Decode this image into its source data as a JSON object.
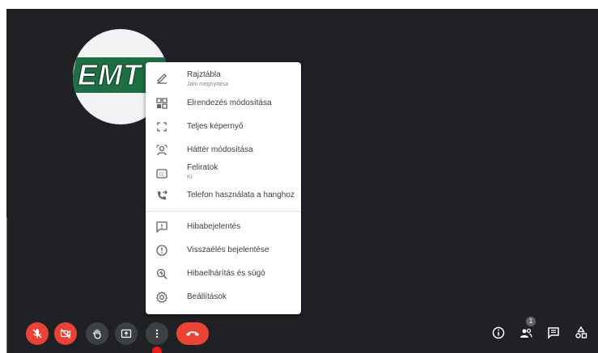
{
  "participant": {
    "logo_text": "EMT"
  },
  "menu": {
    "items": [
      {
        "label": "Rajztábla",
        "sub": "Jam megnyitása",
        "icon": "pencil-icon"
      },
      {
        "label": "Elrendezés módosítása",
        "icon": "layout-icon"
      },
      {
        "label": "Teljes képernyő",
        "icon": "fullscreen-icon"
      },
      {
        "label": "Háttér módosítása",
        "icon": "background-person-icon"
      },
      {
        "label": "Feliratok",
        "sub": "Ki",
        "icon": "closed-caption-icon"
      },
      {
        "label": "Telefon használata a hanghoz",
        "icon": "phone-forward-icon"
      },
      {
        "label": "Hibabejelentés",
        "icon": "feedback-icon"
      },
      {
        "label": "Visszaélés bejelentése",
        "icon": "alert-circle-icon"
      },
      {
        "label": "Hibaelhárítás és súgó",
        "icon": "troubleshoot-icon"
      },
      {
        "label": "Beállítások",
        "icon": "gear-icon"
      }
    ]
  },
  "controls": {
    "people_count": "1"
  },
  "colors": {
    "background": "#202124",
    "danger": "#ea4335",
    "control_grey": "#3c4043",
    "menu_text": "#3c4043"
  }
}
